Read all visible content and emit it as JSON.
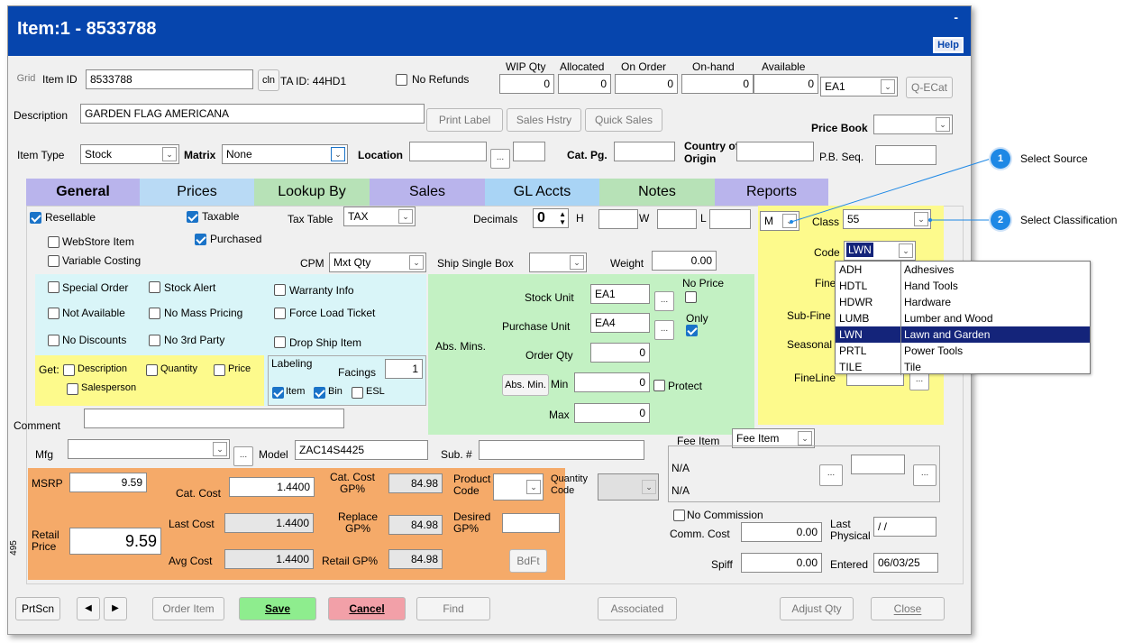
{
  "window": {
    "title": "Item:1 - 8533788",
    "help": "Help",
    "minimize": "-"
  },
  "header": {
    "grid": "Grid",
    "item_id_label": "Item ID",
    "item_id": "8533788",
    "cln": "cln",
    "ta_id": "TA ID: 44HD1",
    "no_refunds": "No Refunds",
    "qty_headers": [
      "WIP Qty",
      "Allocated",
      "On Order",
      "On-hand",
      "Available"
    ],
    "qty_values": [
      "0",
      "0",
      "0",
      "0",
      "0"
    ],
    "unit": "EA1",
    "qecat": "Q-ECat",
    "description_label": "Description",
    "description": "GARDEN FLAG AMERICANA",
    "print_label": "Print Label",
    "sales_history": "Sales Hstry",
    "quick_sales": "Quick Sales",
    "price_book_label": "Price Book",
    "price_book": "",
    "item_type_label": "Item Type",
    "item_type": "Stock",
    "matrix_label": "Matrix",
    "matrix": "None",
    "location_label": "Location",
    "location": "",
    "cat_pg_label": "Cat. Pg.",
    "cat_pg": "",
    "country_label_1": "Country of",
    "country_label_2": "Origin",
    "country": "",
    "pb_seq_label": "P.B. Seq.",
    "pb_seq": ""
  },
  "tabs": [
    {
      "label": "General",
      "color": "#b9b4ec"
    },
    {
      "label": "Prices",
      "color": "#b9daf5"
    },
    {
      "label": "Lookup By",
      "color": "#b7e2b7"
    },
    {
      "label": "Sales",
      "color": "#b9b4ec"
    },
    {
      "label": "GL Accts",
      "color": "#a9d4f5"
    },
    {
      "label": "Notes",
      "color": "#b7e2b7"
    },
    {
      "label": "Reports",
      "color": "#b9b4ec"
    }
  ],
  "general": {
    "resellable": "Resellable",
    "taxable": "Taxable",
    "tax_table_label": "Tax Table",
    "tax_table": "TAX",
    "decimals_label": "Decimals",
    "decimals": "0",
    "h_label": "H",
    "w_label": "W",
    "l_label": "L",
    "webstore": "WebStore Item",
    "purchased": "Purchased",
    "variable_costing": "Variable Costing",
    "cpm_label": "CPM",
    "cpm": "Mxt Qty",
    "ship_single_label": "Ship Single Box",
    "weight_label": "Weight",
    "weight": "0.00",
    "special_order": "Special Order",
    "stock_alert": "Stock Alert",
    "warranty_info": "Warranty Info",
    "not_available": "Not Available",
    "no_mass_pricing": "No Mass Pricing",
    "force_load_ticket": "Force Load Ticket",
    "no_discounts": "No Discounts",
    "no_3rd_party": "No 3rd Party",
    "drop_ship": "Drop Ship Item",
    "get_label": "Get:",
    "get_description": "Description",
    "get_quantity": "Quantity",
    "get_price": "Price",
    "get_salesperson": "Salesperson",
    "labeling_label": "Labeling",
    "facings_label": "Facings",
    "facings": "1",
    "lab_item": "Item",
    "lab_bin": "Bin",
    "lab_esl": "ESL",
    "stock_unit_label": "Stock Unit",
    "stock_unit": "EA1",
    "purchase_unit_label": "Purchase Unit",
    "purchase_unit": "EA4",
    "no_price_1": "No Price",
    "only": "Only",
    "abs_mins_label": "Abs. Mins.",
    "order_qty_label": "Order Qty",
    "order_qty": "0",
    "abs_min_btn": "Abs. Min.",
    "min_label": "Min",
    "min": "0",
    "protect": "Protect",
    "max_label": "Max",
    "max": "0",
    "comment_label": "Comment",
    "comment": ""
  },
  "classification": {
    "source": "M",
    "class_label": "Class",
    "class": "55",
    "code_label": "Code",
    "code": "LWN",
    "fine_label": "Fine",
    "subfine_label": "Sub-Fine",
    "seasonal_label": "Seasonal",
    "fineline_label": "FineLine",
    "options": [
      {
        "code": "ADH",
        "desc": "Adhesives"
      },
      {
        "code": "HDTL",
        "desc": "Hand Tools"
      },
      {
        "code": "HDWR",
        "desc": "Hardware"
      },
      {
        "code": "LUMB",
        "desc": "Lumber and Wood"
      },
      {
        "code": "LWN",
        "desc": "Lawn and Garden"
      },
      {
        "code": "PRTL",
        "desc": "Power Tools"
      },
      {
        "code": "TILE",
        "desc": "Tile"
      }
    ]
  },
  "mfg": {
    "mfg_label": "Mfg",
    "mfg": "",
    "model_label": "Model",
    "model": "ZAC14S4425",
    "sub_label": "Sub. #",
    "sub": "",
    "fee_item_label": "Fee Item",
    "fee_item": "Fee Item",
    "na1": "N/A",
    "na2": "N/A"
  },
  "pricing": {
    "msrp_label": "MSRP",
    "msrp": "9.59",
    "cat_cost_label": "Cat. Cost",
    "cat_cost": "1.4400",
    "cat_cost_gp_label_1": "Cat. Cost",
    "cat_cost_gp_label_2": "GP%",
    "cat_cost_gp": "84.98",
    "product_code_1": "Product",
    "product_code_2": "Code",
    "quantity_code_1": "Quantity",
    "quantity_code_2": "Code",
    "retail_price_label_1": "Retail",
    "retail_price_label_2": "Price",
    "retail_price": "9.59",
    "last_cost_label": "Last Cost",
    "last_cost": "1.4400",
    "replace_gp_label_1": "Replace",
    "replace_gp_label_2": "GP%",
    "replace_gp": "84.98",
    "desired_gp_label_1": "Desired",
    "desired_gp_label_2": "GP%",
    "desired_gp": "",
    "avg_cost_label": "Avg Cost",
    "avg_cost": "1.4400",
    "retail_gp_label": "Retail GP%",
    "retail_gp": "84.98",
    "bdft": "BdFt",
    "side_num": "495"
  },
  "commission": {
    "no_commission": "No Commission",
    "comm_cost_label": "Comm. Cost",
    "comm_cost": "0.00",
    "last_physical_1": "Last",
    "last_physical_2": "Physical",
    "last_physical": "/ /",
    "spiff_label": "Spiff",
    "spiff": "0.00",
    "entered_label": "Entered",
    "entered": "06/03/25"
  },
  "footer": {
    "prtscn": "PrtScn",
    "order_item": "Order Item",
    "save": "Save",
    "cancel": "Cancel",
    "find": "Find",
    "associated": "Associated",
    "adjust_qty": "Adjust Qty",
    "close": "Close"
  },
  "callouts": [
    {
      "num": "1",
      "label": "Select Source"
    },
    {
      "num": "2",
      "label": "Select Classification"
    }
  ]
}
